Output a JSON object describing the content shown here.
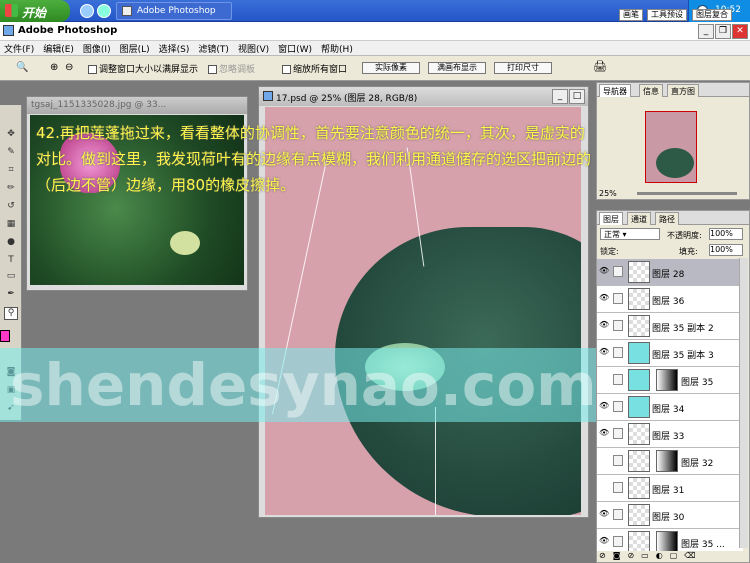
{
  "taskbar": {
    "start_label": "开始",
    "task_label": "Adobe Photoshop",
    "clock": "10:52"
  },
  "app": {
    "title": "Adobe Photoshop"
  },
  "menu": [
    "文件(F)",
    "编辑(E)",
    "图像(I)",
    "图层(L)",
    "选择(S)",
    "滤镜(T)",
    "视图(V)",
    "窗口(W)",
    "帮助(H)"
  ],
  "options": {
    "resize_windows": "调整窗口大小以满屏显示",
    "ignore_palettes": "忽略调板",
    "zoom_all": "缩放所有窗口",
    "actual_pixels": "实际像素",
    "fit_screen": "满画布显示",
    "print_size": "打印尺寸"
  },
  "palette_tabs": [
    "画笔",
    "工具预设",
    "图层复合"
  ],
  "doc1": {
    "title": "tgsaj_1151335028.jpg @ 33..."
  },
  "doc2": {
    "title": "17.psd @ 25% (图层 28, RGB/8)"
  },
  "caption": "42.再把莲蓬拖过来，看看整体的协调性，首先要注意颜色的统一，其次，是虚实的对比。做到这里，我发现荷叶有的边缘有点模糊，我们利用通道储存的选区把前边的（后边不管）边缘，用80的橡皮擦掉。",
  "watermark": "shendesynao.com",
  "navigator": {
    "tabs": [
      "导航器",
      "信息",
      "直方图"
    ],
    "zoom": "25%"
  },
  "layers_panel": {
    "tabs": [
      "图层",
      "通道",
      "路径"
    ],
    "blend_mode": "正常",
    "opacity_label": "不透明度:",
    "opacity": "100%",
    "lock_label": "锁定:",
    "fill_label": "填充:",
    "fill": "100%",
    "layers": [
      {
        "name": "图层 28",
        "selected": true,
        "visible": true,
        "mask": false,
        "thumb": "checker"
      },
      {
        "name": "图层 36",
        "selected": false,
        "visible": true,
        "mask": false,
        "thumb": "checker"
      },
      {
        "name": "图层 35 副本 2",
        "selected": false,
        "visible": true,
        "mask": false,
        "thumb": "checker"
      },
      {
        "name": "图层 35 副本 3",
        "selected": false,
        "visible": true,
        "mask": false,
        "thumb": "cyan"
      },
      {
        "name": "图层 35",
        "selected": false,
        "visible": false,
        "mask": true,
        "thumb": "cyan"
      },
      {
        "name": "图层 34",
        "selected": false,
        "visible": true,
        "mask": false,
        "thumb": "cyan"
      },
      {
        "name": "图层 33",
        "selected": false,
        "visible": true,
        "mask": false,
        "thumb": "checker"
      },
      {
        "name": "图层 32",
        "selected": false,
        "visible": false,
        "mask": true,
        "thumb": "checker"
      },
      {
        "name": "图层 31",
        "selected": false,
        "visible": false,
        "mask": false,
        "thumb": "checker"
      },
      {
        "name": "图层 30",
        "selected": false,
        "visible": true,
        "mask": false,
        "thumb": "checker"
      },
      {
        "name": "图层 35 ...",
        "selected": false,
        "visible": true,
        "mask": true,
        "thumb": "checker"
      }
    ]
  },
  "colors": {
    "foreground": "#ff38c8",
    "caption": "#fff84a",
    "taskbar": "#2456c8"
  }
}
